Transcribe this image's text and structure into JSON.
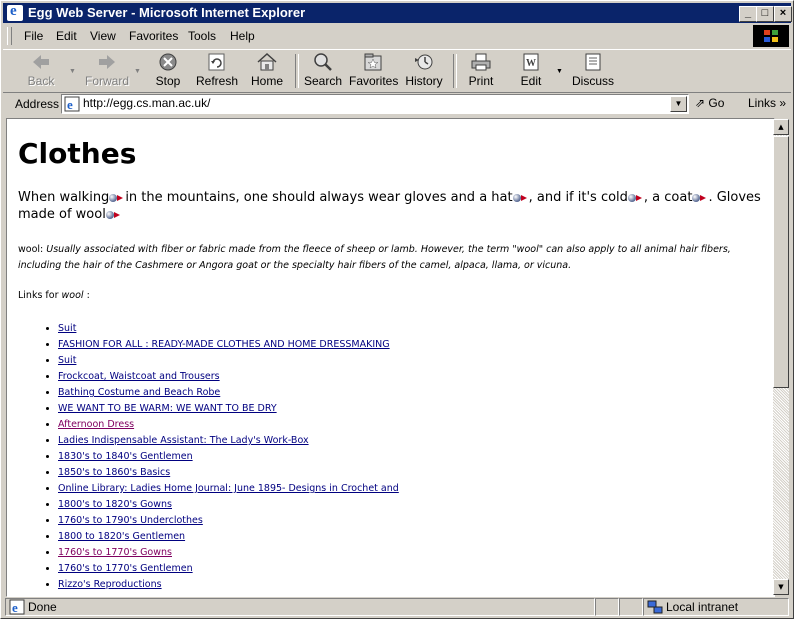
{
  "window": {
    "title": "Egg Web Server - Microsoft Internet Explorer"
  },
  "menu": {
    "items": [
      "File",
      "Edit",
      "View",
      "Favorites",
      "Tools",
      "Help"
    ]
  },
  "toolbar": {
    "buttons": [
      {
        "label": "Back",
        "icon": "back-arrow-icon",
        "enabled": false
      },
      {
        "label": "Forward",
        "icon": "forward-arrow-icon",
        "enabled": false
      },
      {
        "label": "Stop",
        "icon": "stop-icon",
        "enabled": true
      },
      {
        "label": "Refresh",
        "icon": "refresh-icon",
        "enabled": true
      },
      {
        "label": "Home",
        "icon": "home-icon",
        "enabled": true
      },
      {
        "label": "Search",
        "icon": "search-icon",
        "enabled": true
      },
      {
        "label": "Favorites",
        "icon": "favorites-icon",
        "enabled": true
      },
      {
        "label": "History",
        "icon": "history-icon",
        "enabled": true
      },
      {
        "label": "Print",
        "icon": "print-icon",
        "enabled": true
      },
      {
        "label": "Edit",
        "icon": "edit-icon",
        "enabled": true
      },
      {
        "label": "Discuss",
        "icon": "discuss-icon",
        "enabled": true
      }
    ]
  },
  "address": {
    "label": "Address",
    "url": "http://egg.cs.man.ac.uk/",
    "go_label": "Go",
    "links_label": "Links"
  },
  "page": {
    "heading": "Clothes",
    "para": {
      "p1": "When walking",
      "p2": "in the mountains, one should always wear gloves and a hat",
      "p3": ", and if it's cold",
      "p4": ", a coat",
      "p5": ". Gloves made of wool"
    },
    "definition": {
      "term": "wool:",
      "text": "Usually associated with fiber or fabric made from the fleece of sheep or lamb. However, the term \"wool\" can also apply to all animal hair fibers, including the hair of the Cashmere or Angora goat or the specialty hair fibers of the camel, alpaca, llama, or vicuna."
    },
    "links_for": {
      "prefix": "Links for",
      "term": "wool",
      "suffix": ":"
    },
    "links": [
      {
        "text": "Suit",
        "visited": false
      },
      {
        "text": "FASHION FOR ALL : READY-MADE CLOTHES AND HOME DRESSMAKING",
        "visited": false
      },
      {
        "text": "Suit",
        "visited": false
      },
      {
        "text": "Frockcoat, Waistcoat and Trousers",
        "visited": false
      },
      {
        "text": "Bathing Costume and Beach Robe",
        "visited": false
      },
      {
        "text": "WE WANT TO BE WARM: WE WANT TO BE DRY",
        "visited": false
      },
      {
        "text": "Afternoon Dress",
        "visited": true
      },
      {
        "text": "Ladies Indispensable Assistant: The Lady's Work-Box",
        "visited": false
      },
      {
        "text": "1830's to 1840's Gentlemen",
        "visited": false
      },
      {
        "text": "1850's to 1860's Basics",
        "visited": false
      },
      {
        "text": "Online Library: Ladies Home Journal: June 1895- Designs in Crochet and",
        "visited": false
      },
      {
        "text": "1800's to 1820's Gowns",
        "visited": false
      },
      {
        "text": "1760's to 1790's Underclothes",
        "visited": false
      },
      {
        "text": "1800 to 1820's Gentlemen",
        "visited": false
      },
      {
        "text": "1760's to 1770's Gowns",
        "visited": true
      },
      {
        "text": "1760's to 1770's Gentlemen",
        "visited": false
      },
      {
        "text": "Rizzo's Reproductions",
        "visited": false
      }
    ]
  },
  "status": {
    "text": "Done",
    "zone": "Local intranet"
  },
  "colors": {
    "titlebar": "#0a246a",
    "link": "#000080",
    "visited": "#800060",
    "chrome": "#d4d0c8"
  }
}
